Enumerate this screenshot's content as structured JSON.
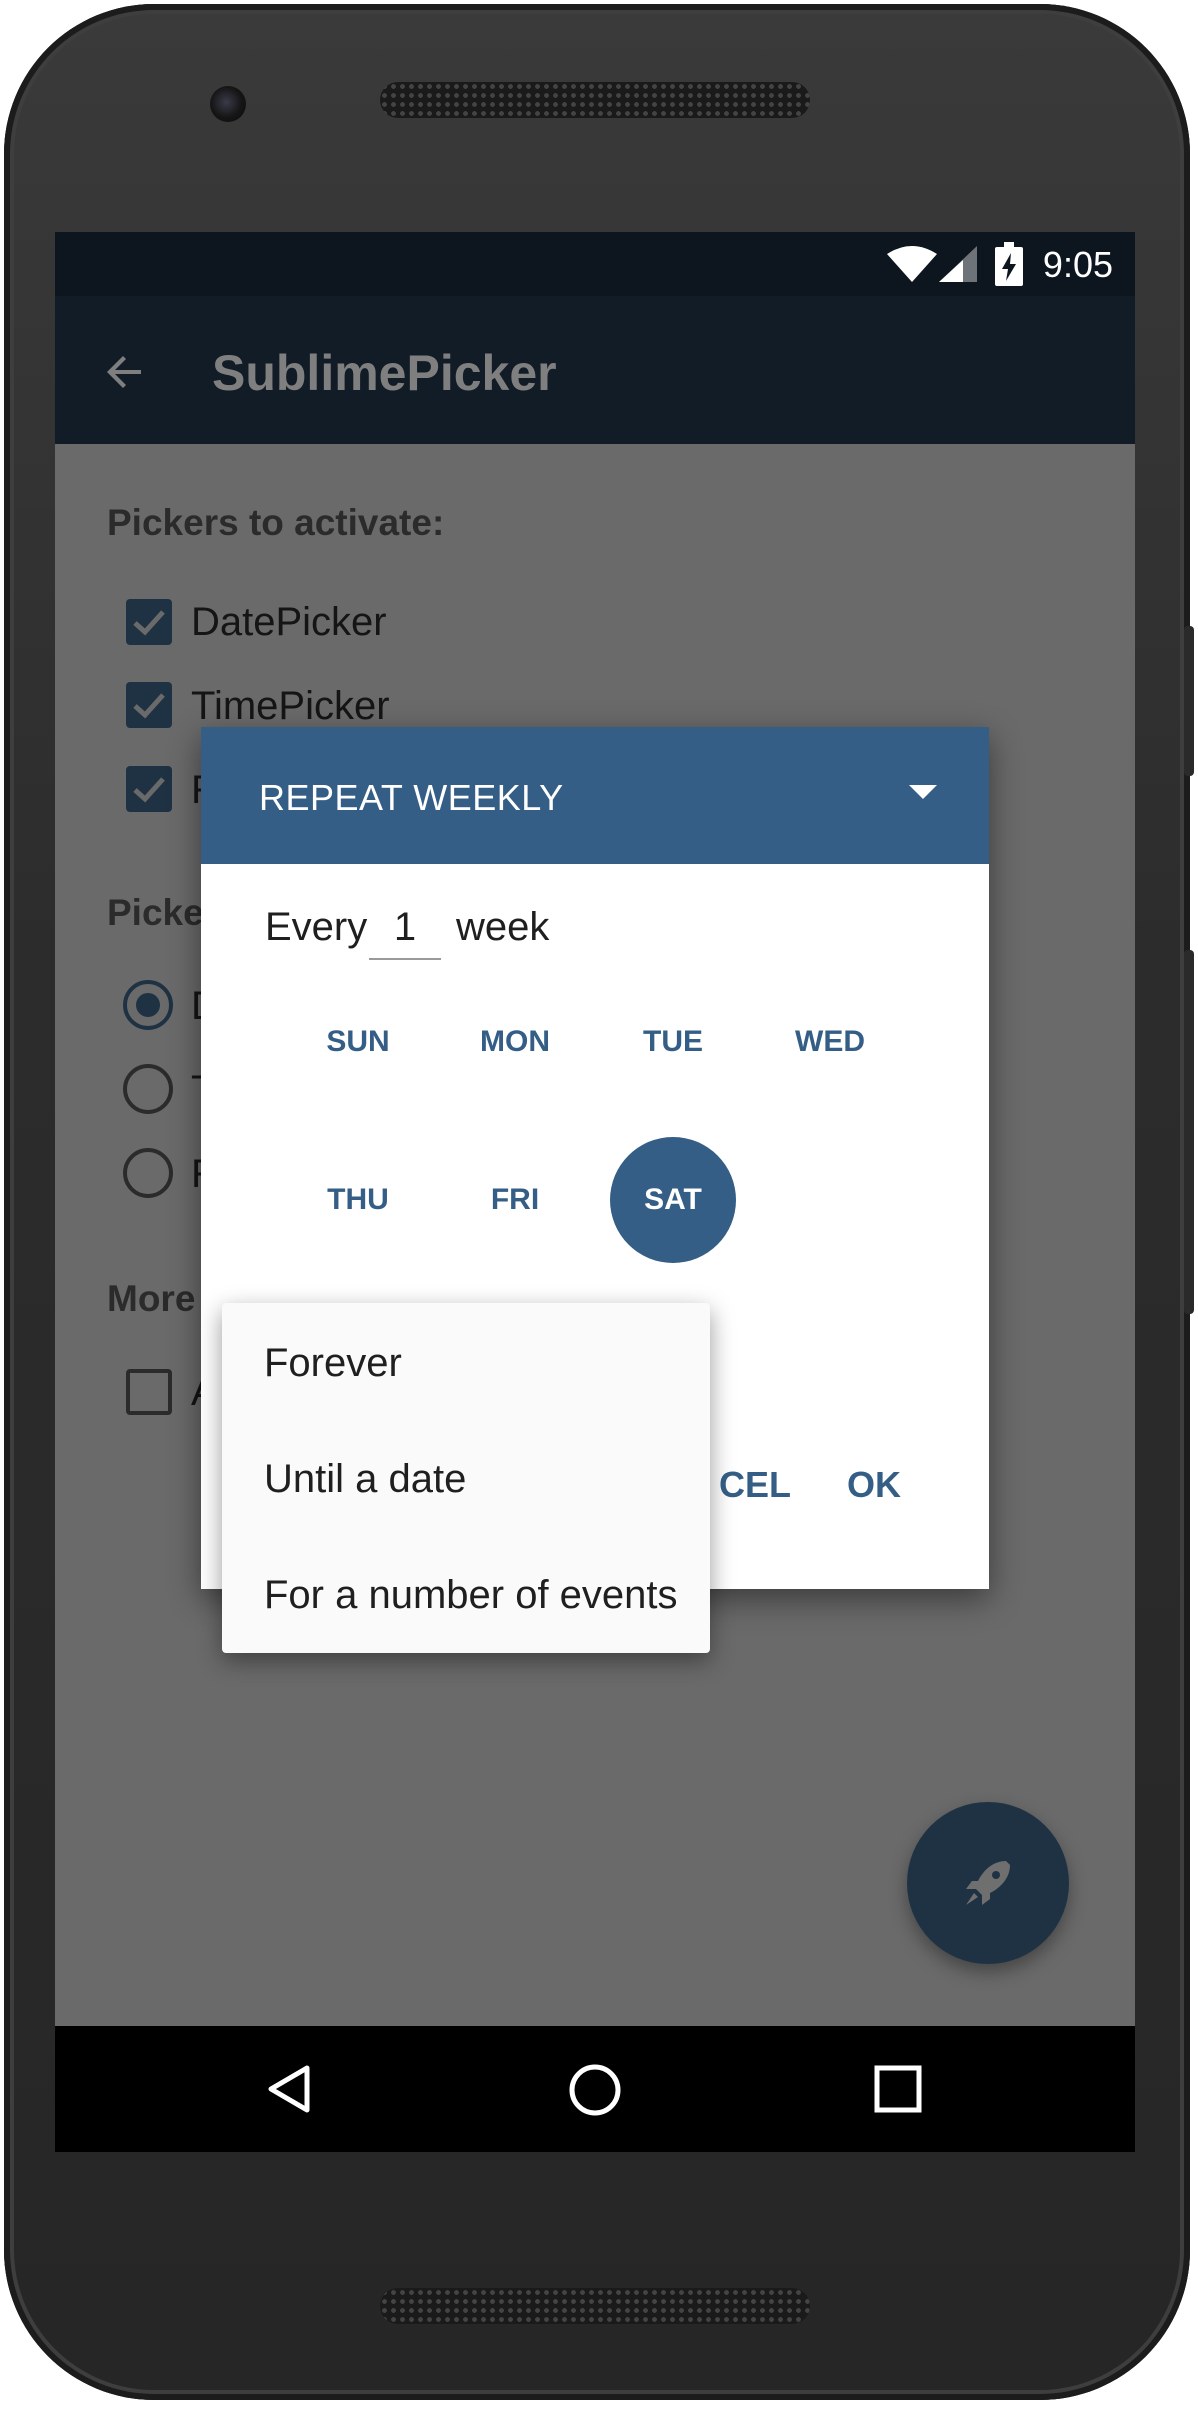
{
  "status_bar": {
    "time": "9:05",
    "icons": [
      "wifi-icon",
      "cell-signal-icon",
      "battery-charging-icon"
    ]
  },
  "toolbar": {
    "title": "SublimePicker",
    "back_icon": "arrow-left-icon"
  },
  "background": {
    "section_pickers": "Pickers to activate:",
    "checkboxes": [
      {
        "label": "DatePicker",
        "checked": true
      },
      {
        "label": "TimePicker",
        "checked": true
      },
      {
        "label": "R",
        "checked": true
      }
    ],
    "section_picker_default": "Picke",
    "radios": [
      {
        "label": "D",
        "selected": true
      },
      {
        "label": "T",
        "selected": false
      },
      {
        "label": "R",
        "selected": false
      }
    ],
    "section_more": "More",
    "more_checkbox": {
      "label": "A",
      "checked": false
    }
  },
  "dialog": {
    "header_title": "REPEAT WEEKLY",
    "every_prefix": "Every",
    "every_value": "1",
    "every_suffix": "week",
    "days_row1": [
      "SUN",
      "MON",
      "TUE",
      "WED"
    ],
    "days_row2": [
      "THU",
      "FRI",
      "SAT"
    ],
    "selected_day": "SAT",
    "cancel_label_visible": "CEL",
    "ok_label": "OK"
  },
  "popup_menu": {
    "items": [
      "Forever",
      "Until a date",
      "For a number of events"
    ]
  },
  "fab_icon": "rocket-icon",
  "nav": {
    "icons": [
      "back-triangle-icon",
      "home-circle-icon",
      "recents-square-icon"
    ]
  },
  "colors": {
    "accent": "#355e86",
    "toolbar": "#111c27",
    "status_bar": "#0d161f",
    "scrim": "#6a6a6a"
  }
}
